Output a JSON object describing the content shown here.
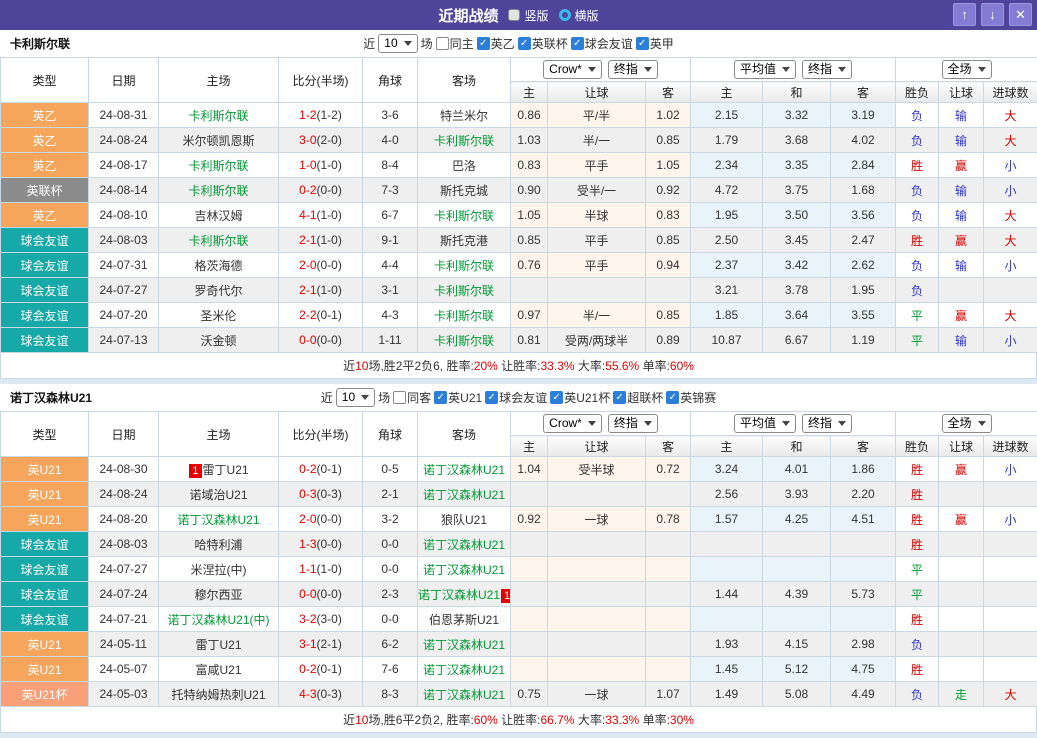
{
  "title_bar": {
    "title": "近期战绩",
    "view_options": [
      {
        "label": "竖版",
        "selected": true
      },
      {
        "label": "横版",
        "selected": false
      }
    ],
    "buttons": {
      "up": "↑",
      "down": "↓",
      "close": "✕"
    }
  },
  "colors": {
    "title_bar": "#4f4499",
    "badge_orange": "#f6a55c",
    "badge_gray": "#8c8c8c",
    "badge_teal": "#17a8a8",
    "badge_salmon": "#f9a078",
    "team_self_green": "#009933",
    "score_red": "#e60000",
    "result_red": "#d60000",
    "result_blue": "#3333cc",
    "result_green": "#009933",
    "let_col_bg": "#fdf5ec",
    "avg_col_bg": "#e8f4f9"
  },
  "table_header": {
    "col_type": "类型",
    "col_date": "日期",
    "col_home": "主场",
    "col_score": "比分(半场)",
    "col_corner": "角球",
    "col_away": "客场",
    "odds_selects": {
      "bookmaker": "Crow*",
      "bookmaker_stage": "终指",
      "avg": "平均值",
      "avg_stage": "终指",
      "fulltime": "全场"
    },
    "sub": {
      "let_home": "主",
      "let_line": "让球",
      "let_away": "客",
      "avg_home": "主",
      "avg_draw": "和",
      "avg_away": "客",
      "result": "胜负",
      "let_result": "让球",
      "goals": "进球数"
    }
  },
  "sections": [
    {
      "team": "卡利斯尔联",
      "filter": {
        "near": "近",
        "count": "10",
        "unit": "场",
        "same": {
          "label": "同主",
          "checked": false
        },
        "leagues": [
          {
            "label": "英乙",
            "checked": true
          },
          {
            "label": "英联杯",
            "checked": true
          },
          {
            "label": "球会友谊",
            "checked": true
          },
          {
            "label": "英甲",
            "checked": true
          }
        ]
      },
      "rows": [
        {
          "league": {
            "label": "英乙",
            "type": "orange"
          },
          "date": "24-08-31",
          "home": {
            "name": "卡利斯尔联",
            "self": true
          },
          "score_ft": "1-2",
          "score_ht": "(1-2)",
          "corner": "3-6",
          "away": {
            "name": "特兰米尔",
            "self": false
          },
          "let_home": "0.86",
          "let_line": "平/半",
          "let_away": "1.02",
          "avg_home": "2.15",
          "avg_draw": "3.32",
          "avg_away": "3.19",
          "result": {
            "text": "负",
            "c": "blue"
          },
          "let_result": {
            "text": "输",
            "c": "blue"
          },
          "goals": {
            "text": "大",
            "c": "red"
          }
        },
        {
          "league": {
            "label": "英乙",
            "type": "orange"
          },
          "date": "24-08-24",
          "home": {
            "name": "米尔顿凯恩斯",
            "self": false
          },
          "score_ft": "3-0",
          "score_ht": "(2-0)",
          "corner": "4-0",
          "away": {
            "name": "卡利斯尔联",
            "self": true
          },
          "let_home": "1.03",
          "let_line": "半/一",
          "let_away": "0.85",
          "avg_home": "1.79",
          "avg_draw": "3.68",
          "avg_away": "4.02",
          "result": {
            "text": "负",
            "c": "blue"
          },
          "let_result": {
            "text": "输",
            "c": "blue"
          },
          "goals": {
            "text": "大",
            "c": "red"
          }
        },
        {
          "league": {
            "label": "英乙",
            "type": "orange"
          },
          "date": "24-08-17",
          "home": {
            "name": "卡利斯尔联",
            "self": true
          },
          "score_ft": "1-0",
          "score_ht": "(1-0)",
          "corner": "8-4",
          "away": {
            "name": "巴洛",
            "self": false
          },
          "let_home": "0.83",
          "let_line": "平手",
          "let_away": "1.05",
          "avg_home": "2.34",
          "avg_draw": "3.35",
          "avg_away": "2.84",
          "result": {
            "text": "胜",
            "c": "red"
          },
          "let_result": {
            "text": "赢",
            "c": "red"
          },
          "goals": {
            "text": "小",
            "c": "blue"
          }
        },
        {
          "league": {
            "label": "英联杯",
            "type": "gray"
          },
          "date": "24-08-14",
          "home": {
            "name": "卡利斯尔联",
            "self": true
          },
          "score_ft": "0-2",
          "score_ht": "(0-0)",
          "corner": "7-3",
          "away": {
            "name": "斯托克城",
            "self": false
          },
          "let_home": "0.90",
          "let_line": "受半/一",
          "let_away": "0.92",
          "avg_home": "4.72",
          "avg_draw": "3.75",
          "avg_away": "1.68",
          "result": {
            "text": "负",
            "c": "blue"
          },
          "let_result": {
            "text": "输",
            "c": "blue"
          },
          "goals": {
            "text": "小",
            "c": "blue"
          }
        },
        {
          "league": {
            "label": "英乙",
            "type": "orange"
          },
          "date": "24-08-10",
          "home": {
            "name": "吉林汉姆",
            "self": false
          },
          "score_ft": "4-1",
          "score_ht": "(1-0)",
          "corner": "6-7",
          "away": {
            "name": "卡利斯尔联",
            "self": true
          },
          "let_home": "1.05",
          "let_line": "半球",
          "let_away": "0.83",
          "avg_home": "1.95",
          "avg_draw": "3.50",
          "avg_away": "3.56",
          "result": {
            "text": "负",
            "c": "blue"
          },
          "let_result": {
            "text": "输",
            "c": "blue"
          },
          "goals": {
            "text": "大",
            "c": "red"
          }
        },
        {
          "league": {
            "label": "球会友谊",
            "type": "teal"
          },
          "date": "24-08-03",
          "home": {
            "name": "卡利斯尔联",
            "self": true
          },
          "score_ft": "2-1",
          "score_ht": "(1-0)",
          "corner": "9-1",
          "away": {
            "name": "斯托克港",
            "self": false
          },
          "let_home": "0.85",
          "let_line": "平手",
          "let_away": "0.85",
          "avg_home": "2.50",
          "avg_draw": "3.45",
          "avg_away": "2.47",
          "result": {
            "text": "胜",
            "c": "red"
          },
          "let_result": {
            "text": "赢",
            "c": "red"
          },
          "goals": {
            "text": "大",
            "c": "red"
          }
        },
        {
          "league": {
            "label": "球会友谊",
            "type": "teal"
          },
          "date": "24-07-31",
          "home": {
            "name": "格茨海德",
            "self": false
          },
          "score_ft": "2-0",
          "score_ht": "(0-0)",
          "corner": "4-4",
          "away": {
            "name": "卡利斯尔联",
            "self": true
          },
          "let_home": "0.76",
          "let_line": "平手",
          "let_away": "0.94",
          "avg_home": "2.37",
          "avg_draw": "3.42",
          "avg_away": "2.62",
          "result": {
            "text": "负",
            "c": "blue"
          },
          "let_result": {
            "text": "输",
            "c": "blue"
          },
          "goals": {
            "text": "小",
            "c": "blue"
          }
        },
        {
          "league": {
            "label": "球会友谊",
            "type": "teal"
          },
          "date": "24-07-27",
          "home": {
            "name": "罗奇代尔",
            "self": false
          },
          "score_ft": "2-1",
          "score_ht": "(1-0)",
          "corner": "3-1",
          "away": {
            "name": "卡利斯尔联",
            "self": true
          },
          "let_home": "",
          "let_line": "",
          "let_away": "",
          "avg_home": "3.21",
          "avg_draw": "3.78",
          "avg_away": "1.95",
          "result": {
            "text": "负",
            "c": "blue"
          },
          "let_result": null,
          "goals": null
        },
        {
          "league": {
            "label": "球会友谊",
            "type": "teal"
          },
          "date": "24-07-20",
          "home": {
            "name": "圣米伦",
            "self": false
          },
          "score_ft": "2-2",
          "score_ht": "(0-1)",
          "corner": "4-3",
          "away": {
            "name": "卡利斯尔联",
            "self": true
          },
          "let_home": "0.97",
          "let_line": "半/一",
          "let_away": "0.85",
          "avg_home": "1.85",
          "avg_draw": "3.64",
          "avg_away": "3.55",
          "result": {
            "text": "平",
            "c": "green"
          },
          "let_result": {
            "text": "赢",
            "c": "red"
          },
          "goals": {
            "text": "大",
            "c": "red"
          }
        },
        {
          "league": {
            "label": "球会友谊",
            "type": "teal"
          },
          "date": "24-07-13",
          "home": {
            "name": "沃金顿",
            "self": false
          },
          "score_ft": "0-0",
          "score_ht": "(0-0)",
          "corner": "1-11",
          "away": {
            "name": "卡利斯尔联",
            "self": true
          },
          "let_home": "0.81",
          "let_line": "受两/两球半",
          "let_away": "0.89",
          "avg_home": "10.87",
          "avg_draw": "6.67",
          "avg_away": "1.19",
          "result": {
            "text": "平",
            "c": "green"
          },
          "let_result": {
            "text": "输",
            "c": "blue"
          },
          "goals": {
            "text": "小",
            "c": "blue"
          }
        }
      ],
      "summary": [
        {
          "text": "近",
          "red": false
        },
        {
          "text": "10",
          "red": true
        },
        {
          "text": "场,胜2平2负6, 胜率:",
          "red": false
        },
        {
          "text": "20%",
          "red": true
        },
        {
          "text": " 让胜率:",
          "red": false
        },
        {
          "text": "33.3%",
          "red": true
        },
        {
          "text": " 大率:",
          "red": false
        },
        {
          "text": "55.6%",
          "red": true
        },
        {
          "text": " 单率:",
          "red": false
        },
        {
          "text": "60%",
          "red": true
        }
      ]
    },
    {
      "team": "诺丁汉森林U21",
      "filter": {
        "near": "近",
        "count": "10",
        "unit": "场",
        "same": {
          "label": "同客",
          "checked": false
        },
        "leagues": [
          {
            "label": "英U21",
            "checked": true
          },
          {
            "label": "球会友谊",
            "checked": true
          },
          {
            "label": "英U21杯",
            "checked": true
          },
          {
            "label": "超联杯",
            "checked": true
          },
          {
            "label": "英锦赛",
            "checked": true
          }
        ]
      },
      "rows": [
        {
          "league": {
            "label": "英U21",
            "type": "orange"
          },
          "date": "24-08-30",
          "home": {
            "name": "雷丁U21",
            "self": false,
            "b1": "1"
          },
          "score_ft": "0-2",
          "score_ht": "(0-1)",
          "corner": "0-5",
          "away": {
            "name": "诺丁汉森林U21",
            "self": true
          },
          "let_home": "1.04",
          "let_line": "受半球",
          "let_away": "0.72",
          "avg_home": "3.24",
          "avg_draw": "4.01",
          "avg_away": "1.86",
          "result": {
            "text": "胜",
            "c": "red"
          },
          "let_result": {
            "text": "赢",
            "c": "red"
          },
          "goals": {
            "text": "小",
            "c": "blue"
          }
        },
        {
          "league": {
            "label": "英U21",
            "type": "orange"
          },
          "date": "24-08-24",
          "home": {
            "name": "诺域治U21",
            "self": false
          },
          "score_ft": "0-3",
          "score_ht": "(0-3)",
          "corner": "2-1",
          "away": {
            "name": "诺丁汉森林U21",
            "self": true
          },
          "let_home": "",
          "let_line": "",
          "let_away": "",
          "avg_home": "2.56",
          "avg_draw": "3.93",
          "avg_away": "2.20",
          "result": {
            "text": "胜",
            "c": "red"
          },
          "let_result": null,
          "goals": null
        },
        {
          "league": {
            "label": "英U21",
            "type": "orange"
          },
          "date": "24-08-20",
          "home": {
            "name": "诺丁汉森林U21",
            "self": true
          },
          "score_ft": "2-0",
          "score_ht": "(0-0)",
          "corner": "3-2",
          "away": {
            "name": "狼队U21",
            "self": false
          },
          "let_home": "0.92",
          "let_line": "一球",
          "let_away": "0.78",
          "avg_home": "1.57",
          "avg_draw": "4.25",
          "avg_away": "4.51",
          "result": {
            "text": "胜",
            "c": "red"
          },
          "let_result": {
            "text": "赢",
            "c": "red"
          },
          "goals": {
            "text": "小",
            "c": "blue"
          }
        },
        {
          "league": {
            "label": "球会友谊",
            "type": "teal"
          },
          "date": "24-08-03",
          "home": {
            "name": "哈特利浦",
            "self": false
          },
          "score_ft": "1-3",
          "score_ht": "(0-0)",
          "corner": "0-0",
          "away": {
            "name": "诺丁汉森林U21",
            "self": true
          },
          "let_home": "",
          "let_line": "",
          "let_away": "",
          "avg_home": "",
          "avg_draw": "",
          "avg_away": "",
          "result": {
            "text": "胜",
            "c": "red"
          },
          "let_result": null,
          "goals": null
        },
        {
          "league": {
            "label": "球会友谊",
            "type": "teal"
          },
          "date": "24-07-27",
          "home": {
            "name": "米涅拉(中)",
            "self": false
          },
          "score_ft": "1-1",
          "score_ht": "(1-0)",
          "corner": "0-0",
          "away": {
            "name": "诺丁汉森林U21",
            "self": true
          },
          "let_home": "",
          "let_line": "",
          "let_away": "",
          "avg_home": "",
          "avg_draw": "",
          "avg_away": "",
          "result": {
            "text": "平",
            "c": "green"
          },
          "let_result": null,
          "goals": null
        },
        {
          "league": {
            "label": "球会友谊",
            "type": "teal"
          },
          "date": "24-07-24",
          "home": {
            "name": "穆尔西亚",
            "self": false
          },
          "score_ft": "0-0",
          "score_ht": "(0-0)",
          "corner": "2-3",
          "away": {
            "name": "诺丁汉森林U21",
            "self": true,
            "b2": "1"
          },
          "let_home": "",
          "let_line": "",
          "let_away": "",
          "avg_home": "1.44",
          "avg_draw": "4.39",
          "avg_away": "5.73",
          "result": {
            "text": "平",
            "c": "green"
          },
          "let_result": null,
          "goals": null
        },
        {
          "league": {
            "label": "球会友谊",
            "type": "teal"
          },
          "date": "24-07-21",
          "home": {
            "name": "诺丁汉森林U21(中)",
            "self": true
          },
          "score_ft": "3-2",
          "score_ht": "(3-0)",
          "corner": "0-0",
          "away": {
            "name": "伯恩茅斯U21",
            "self": false
          },
          "let_home": "",
          "let_line": "",
          "let_away": "",
          "avg_home": "",
          "avg_draw": "",
          "avg_away": "",
          "result": {
            "text": "胜",
            "c": "red"
          },
          "let_result": null,
          "goals": null
        },
        {
          "league": {
            "label": "英U21",
            "type": "orange"
          },
          "date": "24-05-11",
          "home": {
            "name": "雷丁U21",
            "self": false
          },
          "score_ft": "3-1",
          "score_ht": "(2-1)",
          "corner": "6-2",
          "away": {
            "name": "诺丁汉森林U21",
            "self": true
          },
          "let_home": "",
          "let_line": "",
          "let_away": "",
          "avg_home": "1.93",
          "avg_draw": "4.15",
          "avg_away": "2.98",
          "result": {
            "text": "负",
            "c": "blue"
          },
          "let_result": null,
          "goals": null
        },
        {
          "league": {
            "label": "英U21",
            "type": "orange"
          },
          "date": "24-05-07",
          "home": {
            "name": "富咸U21",
            "self": false
          },
          "score_ft": "0-2",
          "score_ht": "(0-1)",
          "corner": "7-6",
          "away": {
            "name": "诺丁汉森林U21",
            "self": true
          },
          "let_home": "",
          "let_line": "",
          "let_away": "",
          "avg_home": "1.45",
          "avg_draw": "5.12",
          "avg_away": "4.75",
          "result": {
            "text": "胜",
            "c": "red"
          },
          "let_result": null,
          "goals": null
        },
        {
          "league": {
            "label": "英U21杯",
            "type": "salmon"
          },
          "date": "24-05-03",
          "home": {
            "name": "托特纳姆热刺U21",
            "self": false
          },
          "score_ft": "4-3",
          "score_ht": "(0-3)",
          "corner": "8-3",
          "away": {
            "name": "诺丁汉森林U21",
            "self": true
          },
          "let_home": "0.75",
          "let_line": "一球",
          "let_away": "1.07",
          "avg_home": "1.49",
          "avg_draw": "5.08",
          "avg_away": "4.49",
          "result": {
            "text": "负",
            "c": "blue"
          },
          "let_result": {
            "text": "走",
            "c": "green"
          },
          "goals": {
            "text": "大",
            "c": "red"
          }
        }
      ],
      "summary": [
        {
          "text": "近",
          "red": false
        },
        {
          "text": "10",
          "red": true
        },
        {
          "text": "场,胜6平2负2, 胜率:",
          "red": false
        },
        {
          "text": "60%",
          "red": true
        },
        {
          "text": " 让胜率:",
          "red": false
        },
        {
          "text": "66.7%",
          "red": true
        },
        {
          "text": " 大率:",
          "red": false
        },
        {
          "text": "33.3%",
          "red": true
        },
        {
          "text": " 单率:",
          "red": false
        },
        {
          "text": "30%",
          "red": true
        }
      ]
    }
  ]
}
